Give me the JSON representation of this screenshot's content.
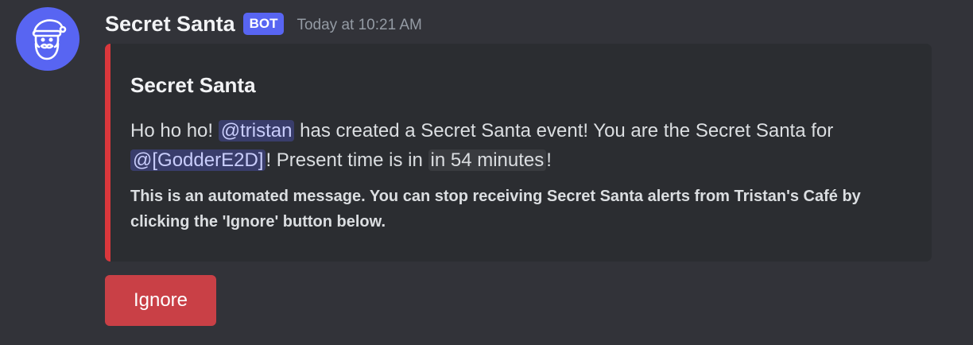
{
  "message": {
    "author": {
      "name": "Secret Santa",
      "tag": "BOT",
      "avatar_icon": "santa-icon",
      "avatar_color": "#5865f2"
    },
    "timestamp": "Today at 10:21 AM",
    "embed": {
      "accent_color": "#da373c",
      "title": "Secret Santa",
      "description": {
        "part1": "Ho ho ho! ",
        "mention1": "@tristan",
        "part2": " has created a Secret Santa event! You are the Secret Santa for ",
        "mention2": "@[GodderE2D]",
        "part3": "! Present time is in ",
        "time_chip": "in 54 minutes",
        "part4": "!"
      },
      "footer_text": "This is an automated message. You can stop receiving Secret Santa alerts from Tristan's Café by clicking the 'Ignore' button below."
    },
    "buttons": [
      {
        "label": "Ignore",
        "style": "danger",
        "color": "#c94046"
      }
    ]
  }
}
